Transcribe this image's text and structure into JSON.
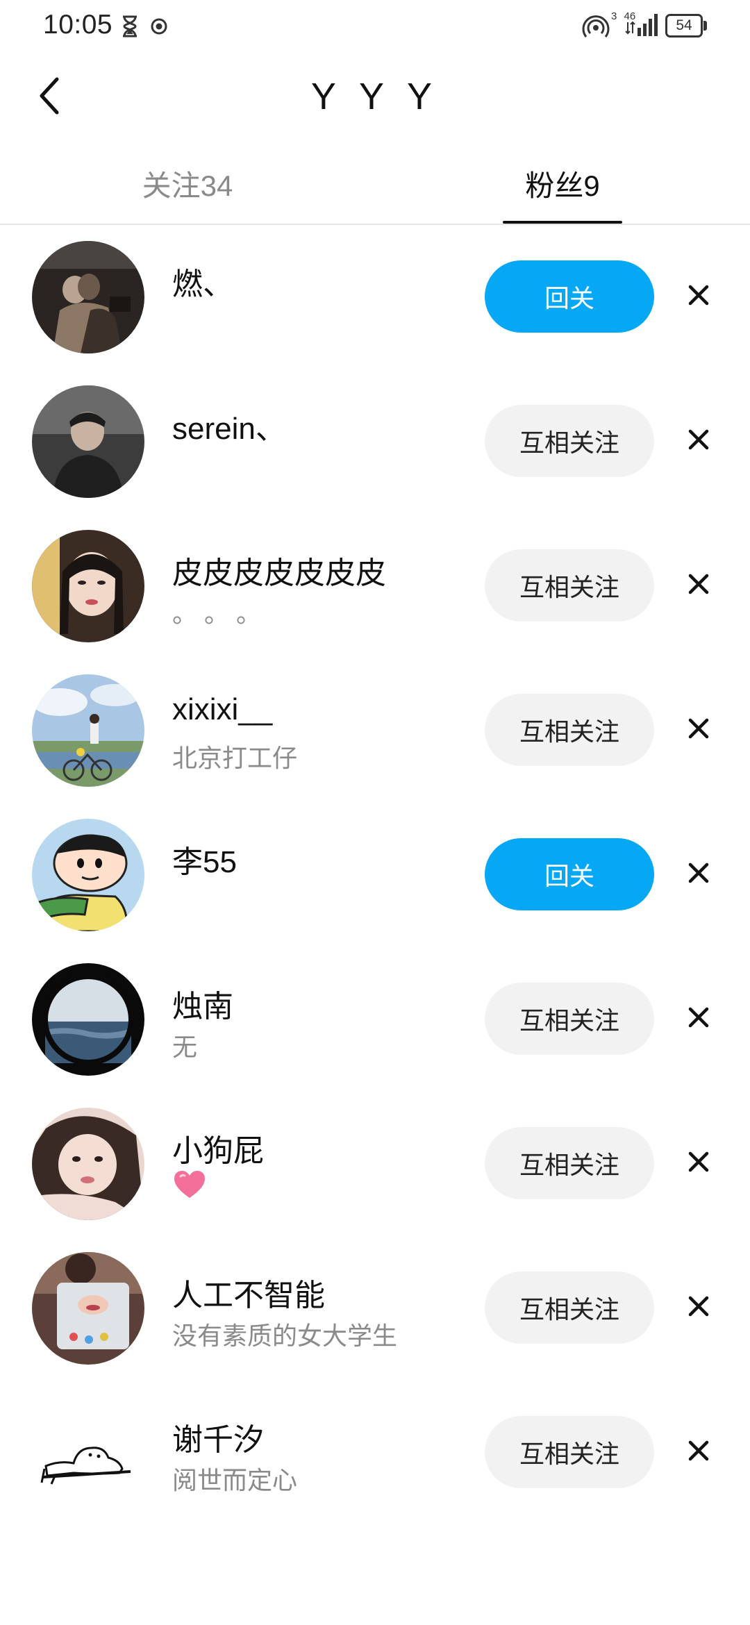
{
  "status_bar": {
    "time": "10:05",
    "network": "46",
    "sim": "3",
    "battery": "54"
  },
  "header": {
    "title": "Y Y Y",
    "back_icon": "chevron-left-icon"
  },
  "tabs": [
    {
      "label": "关注34",
      "active": false
    },
    {
      "label": "粉丝9",
      "active": true
    }
  ],
  "colors": {
    "accent": "#06a7f5",
    "mutual_bg": "#f2f2f2",
    "secondary_text": "#8a8a8a"
  },
  "fans": [
    {
      "name": "燃、",
      "bio": "",
      "button": "回关",
      "button_style": "primary",
      "avatar": "photo-dark-couple"
    },
    {
      "name": "serein、",
      "bio": "",
      "button": "互相关注",
      "button_style": "mutual",
      "avatar": "photo-dark-person"
    },
    {
      "name": "皮皮皮皮皮皮皮",
      "bio": "。 。 。",
      "button": "互相关注",
      "button_style": "mutual",
      "avatar": "photo-girl-face"
    },
    {
      "name": "xixixi__",
      "bio": "北京打工仔",
      "button": "互相关注",
      "button_style": "mutual",
      "avatar": "photo-bicycle-sky"
    },
    {
      "name": "李55",
      "bio": "",
      "button": "回关",
      "button_style": "primary",
      "avatar": "cartoon-boy"
    },
    {
      "name": "烛南",
      "bio": "无",
      "button": "互相关注",
      "button_style": "mutual",
      "avatar": "photo-sea-ring"
    },
    {
      "name": "小狗屁",
      "bio": "",
      "bio_icon": "pink-heart-icon",
      "button": "互相关注",
      "button_style": "mutual",
      "avatar": "photo-girl-lying"
    },
    {
      "name": "人工不智能",
      "bio": "没有素质的女大学生",
      "button": "互相关注",
      "button_style": "mutual",
      "avatar": "photo-laptop"
    },
    {
      "name": "谢千汐",
      "bio": "阅世而定心",
      "button": "互相关注",
      "button_style": "mutual",
      "avatar": "sketch-cat"
    }
  ]
}
